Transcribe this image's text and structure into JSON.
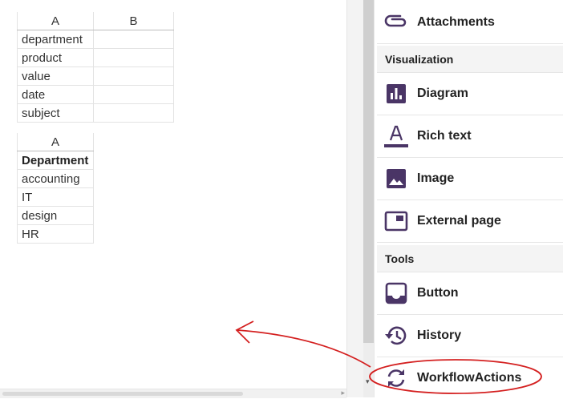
{
  "grid1": {
    "columns": [
      "A",
      "B"
    ],
    "rows": [
      "department",
      "product",
      "value",
      "date",
      "subject"
    ]
  },
  "grid2": {
    "columns": [
      "A"
    ],
    "header": "Department",
    "rows": [
      "accounting",
      "IT",
      "design",
      "HR"
    ]
  },
  "panel": {
    "top_item": {
      "label": "Attachments",
      "icon": "paperclip-icon"
    },
    "sections": [
      {
        "title": "Visualization",
        "items": [
          {
            "label": "Diagram",
            "icon": "bar-chart-icon"
          },
          {
            "label": "Rich text",
            "icon": "text-format-icon"
          },
          {
            "label": "Image",
            "icon": "image-icon"
          },
          {
            "label": "External page",
            "icon": "web-window-icon"
          }
        ]
      },
      {
        "title": "Tools",
        "items": [
          {
            "label": "Button",
            "icon": "inbox-button-icon"
          },
          {
            "label": "History",
            "icon": "history-icon"
          },
          {
            "label": "WorkflowActions",
            "icon": "sync-icon"
          }
        ]
      }
    ]
  },
  "colors": {
    "icon": "#4a3566",
    "annotation": "#d42020"
  }
}
